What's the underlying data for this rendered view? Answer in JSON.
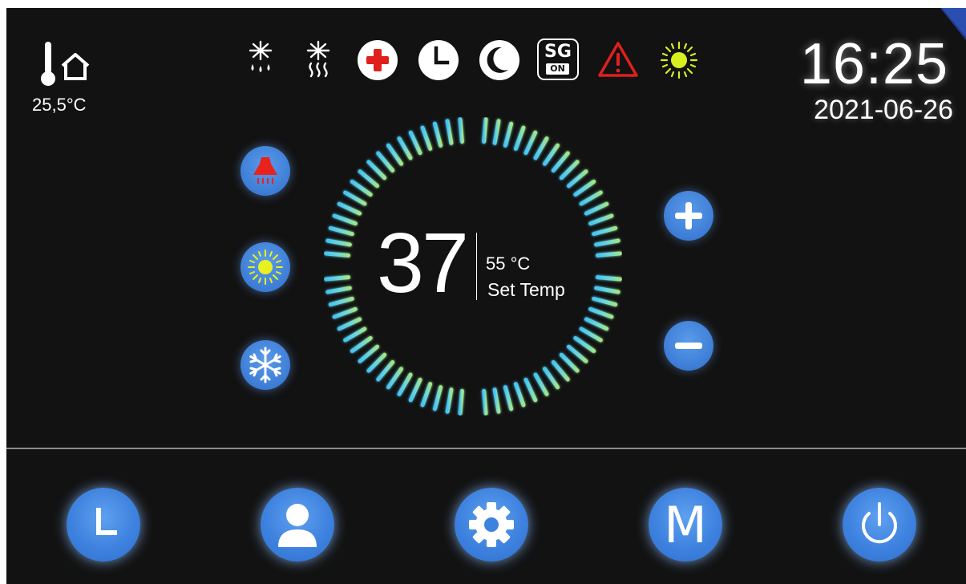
{
  "status": {
    "indoor_temperature": "25,5°C",
    "time": "16:25",
    "date": "2021-06-26"
  },
  "status_icons": [
    {
      "name": "defrost-icon"
    },
    {
      "name": "heating-defrost-icon"
    },
    {
      "name": "medical-cross-icon"
    },
    {
      "name": "clock-icon"
    },
    {
      "name": "moon-icon"
    },
    {
      "name": "sg-on-icon",
      "line1": "SG",
      "line2": "ON"
    },
    {
      "name": "warning-icon"
    },
    {
      "name": "sun-icon"
    }
  ],
  "thermostat": {
    "current": "37",
    "set_value": "55 °C",
    "set_label": "Set Temp"
  },
  "modes": [
    "hot-water-mode",
    "heating-mode",
    "cooling-mode"
  ],
  "nav": {
    "m_label": "M"
  },
  "colors": {
    "background": "#121212",
    "button_blue": "#3e82df",
    "accent_red": "#e0201c",
    "accent_yellow": "#d8f020",
    "ring_cyan": "#5fd0f0",
    "ring_green": "#8ee08a"
  }
}
